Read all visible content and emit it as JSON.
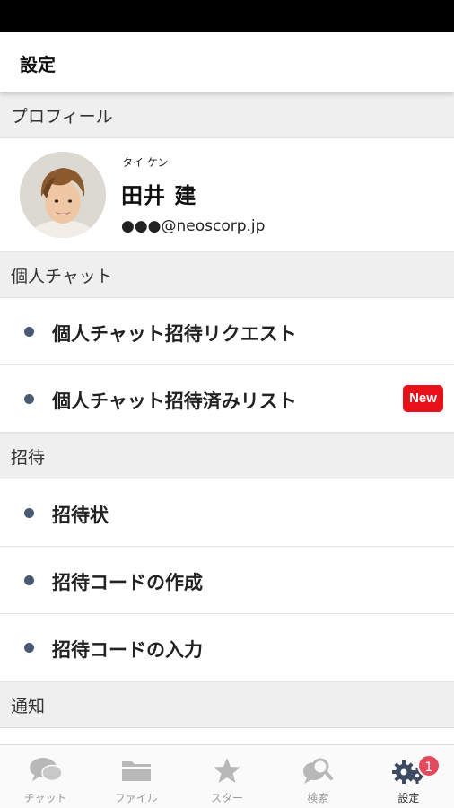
{
  "header": {
    "title": "設定"
  },
  "profile_section": {
    "heading": "プロフィール",
    "kana": "タイ ケン",
    "name": "田井 建",
    "email": "●●●@neoscorp.jp"
  },
  "personal_chat": {
    "heading": "個人チャット",
    "items": [
      {
        "label": "個人チャット招待リクエスト"
      },
      {
        "label": "個人チャット招待済みリスト",
        "badge": "New"
      }
    ]
  },
  "invite": {
    "heading": "招待",
    "items": [
      {
        "label": "招待状"
      },
      {
        "label": "招待コードの作成"
      },
      {
        "label": "招待コードの入力"
      }
    ]
  },
  "notifications": {
    "heading": "通知"
  },
  "tabs": [
    {
      "label": "チャット",
      "icon": "chat-icon",
      "active": false
    },
    {
      "label": "ファイル",
      "icon": "folder-icon",
      "active": false
    },
    {
      "label": "スター",
      "icon": "star-icon",
      "active": false
    },
    {
      "label": "検索",
      "icon": "search-icon",
      "active": false
    },
    {
      "label": "設定",
      "icon": "gear-icon",
      "active": true,
      "badge": "1"
    }
  ],
  "colors": {
    "accent_bullet": "#4a5a72",
    "new_badge": "#e8111a",
    "tab_badge": "#e34a5e",
    "active_icon": "#3d4a63",
    "inactive_icon": "#b8b8b8"
  }
}
